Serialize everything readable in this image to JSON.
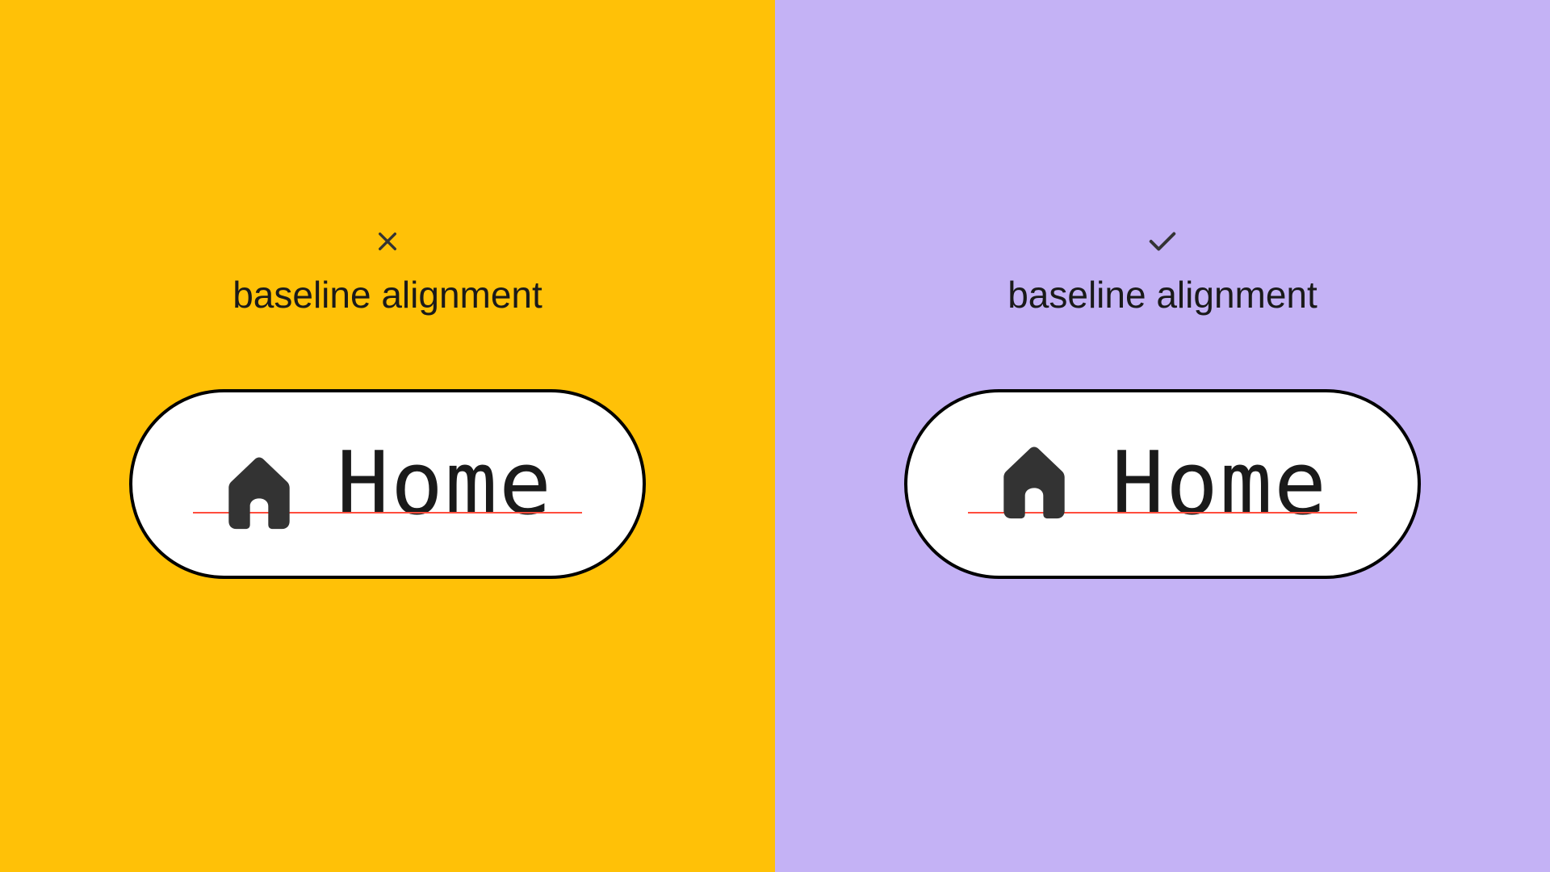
{
  "left": {
    "heading": "baseline alignment",
    "button_label": "Home",
    "status": "incorrect",
    "bg_color": "#FFC107"
  },
  "right": {
    "heading": "baseline alignment",
    "button_label": "Home",
    "status": "correct",
    "bg_color": "#C4B2F5"
  },
  "icons": {
    "x": "x-icon",
    "check": "check-icon",
    "home": "home-icon"
  },
  "baseline_color": "#FF4D3D"
}
